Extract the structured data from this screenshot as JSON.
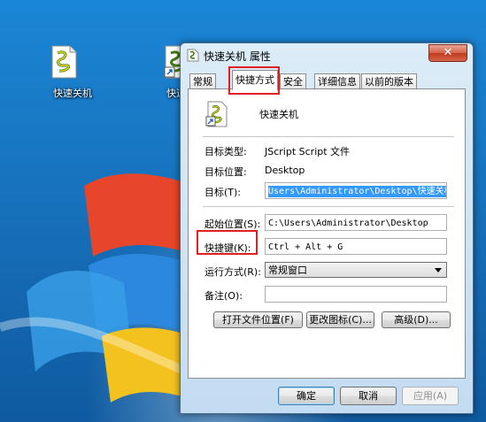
{
  "desktop": {
    "icons": [
      {
        "label": "快速关机"
      },
      {
        "label": "快速关"
      }
    ]
  },
  "window": {
    "title": "快速关机 属性",
    "close_symbol": "✕",
    "tabs": [
      {
        "label": "常规"
      },
      {
        "label": "快捷方式"
      },
      {
        "label": "安全"
      },
      {
        "label": "详细信息"
      },
      {
        "label": "以前的版本"
      }
    ],
    "active_tab": "快捷方式",
    "file_name": "快速关机",
    "target_type_label": "目标类型:",
    "target_type_value": "JScript Script 文件",
    "target_location_label": "目标位置:",
    "target_location_value": "Desktop",
    "target_label": "目标(T):",
    "target_value": "Users\\Administrator\\Desktop\\快速关机.js",
    "start_in_label": "起始位置(S):",
    "start_in_value": "C:\\Users\\Administrator\\Desktop",
    "shortcut_key_label": "快捷键(K):",
    "shortcut_key_value": "Ctrl + Alt + G",
    "run_label": "运行方式(R):",
    "run_value": "常规窗口",
    "comment_label": "备注(O):",
    "comment_value": "",
    "open_location_button": "打开文件位置(F)",
    "change_icon_button": "更改图标(C)...",
    "advanced_button": "高级(D)...",
    "ok_button": "确定",
    "cancel_button": "取消",
    "apply_button": "应用(A)"
  }
}
